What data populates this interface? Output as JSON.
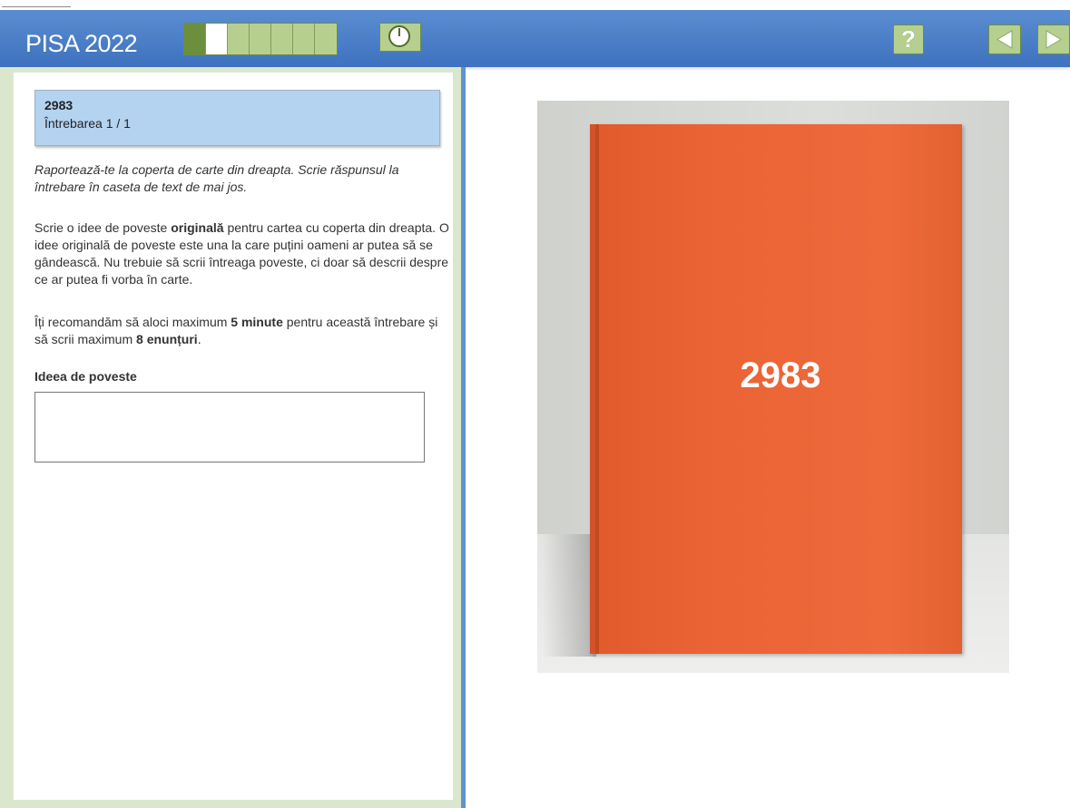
{
  "header": {
    "app_title": "PISA 2022",
    "progress": {
      "total_segments": 7,
      "completed": 1,
      "current": 2
    },
    "help_label": "?"
  },
  "question": {
    "id": "2983",
    "number": "Întrebarea 1 / 1",
    "instruction": "Raportează-te la coperta de carte din dreapta. Scrie răspunsul la întrebare în caseta de text de mai jos.",
    "para1": {
      "pre": "Scrie o idee de poveste ",
      "bold": "originală",
      "post": " pentru cartea cu coperta din dreapta. O idee originală de poveste este una la care puțini oameni ar putea să se gândească. Nu trebuie să scrii întreaga poveste, ci doar să descrii despre ce ar putea fi vorba în carte."
    },
    "para2": {
      "pre": "Îți recomandăm să aloci maximum ",
      "bold1": "5 minute",
      "mid": " pentru această întrebare și să scrii maximum ",
      "bold2": "8 enunțuri",
      "post": "."
    },
    "answer_label": "Ideea de poveste",
    "answer_value": ""
  },
  "book": {
    "title": "2983",
    "cover_color": "#ea6335"
  },
  "colors": {
    "header": "#4a7ec7",
    "frame_green": "#dbe7cc",
    "button_green": "#b6cf8e",
    "qheader_blue": "#b3d3f0"
  },
  "icons": {
    "timer": "clock-icon",
    "help": "question-icon",
    "prev": "arrow-left-icon",
    "next": "arrow-right-icon"
  }
}
